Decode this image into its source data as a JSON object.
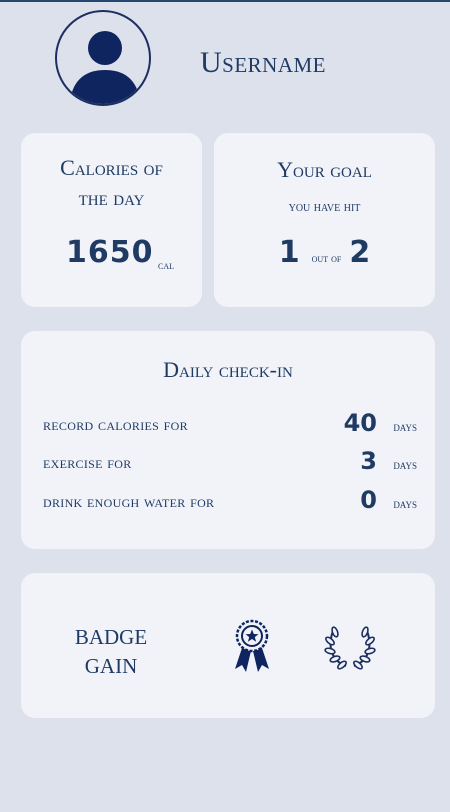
{
  "profile": {
    "username": "Username",
    "avatar_icon": "user-avatar-icon"
  },
  "calories": {
    "title_line1": "Calories of",
    "title_line2": "the day",
    "value": "1650",
    "unit": "cal"
  },
  "goal": {
    "title": "Your goal",
    "subtitle": "you have hit",
    "hit": "1",
    "out_of": "out of",
    "total": "2"
  },
  "checkin": {
    "title": "Daily check-in",
    "rows": [
      {
        "label": "record calories for",
        "value": "40",
        "unit": "days"
      },
      {
        "label": "exercise for",
        "value": "3",
        "unit": "days"
      },
      {
        "label": "drink enough water for",
        "value": "0",
        "unit": "days"
      }
    ]
  },
  "badges": {
    "label_line1": "BADGE",
    "label_line2": "GAIN",
    "icons": [
      "award-ribbon-icon",
      "laurel-wreath-icon"
    ]
  },
  "colors": {
    "background": "#dde1ec",
    "card": "#f1f3f9",
    "text": "#1f3b63",
    "icon": "#1c2f5f"
  }
}
